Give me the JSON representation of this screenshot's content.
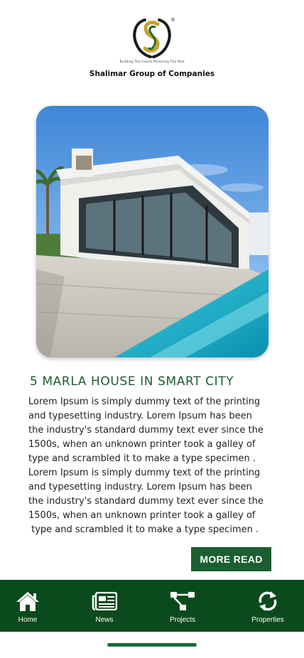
{
  "logo": {
    "tagline": "Building The Future Restoring The Past",
    "company": "Shalimar Group of Companies",
    "registered_mark": "®"
  },
  "article": {
    "title": "5 MARLA HOUSE IN SMART CITY",
    "lines": [
      "Lorem Ipsum is simply dummy text of the printing",
      "and typesetting industry. Lorem Ipsum has been",
      "the industry's standard dummy text ever since the",
      "1500s, when an unknown printer took a galley of",
      "type and scrambled it to make a type specimen .",
      "Lorem Ipsum is simply dummy text of the printing",
      "and typesetting industry. Lorem Ipsum has been",
      "the industry's standard dummy text ever since the",
      "1500s, when an unknown printer took a galley of",
      " type and scrambled it to make a type specimen ."
    ],
    "more_label": "MORE READ"
  },
  "nav": {
    "home": {
      "label": "Home",
      "icon": "home-icon"
    },
    "news": {
      "label": "News",
      "icon": "newspaper-icon"
    },
    "projects": {
      "label": "Projects",
      "icon": "sitemap-icon"
    },
    "properties": {
      "label": "Properties",
      "icon": "refresh-icon"
    }
  },
  "colors": {
    "brand_green": "#1a5c2e",
    "nav_background": "#0b4a1c",
    "logo_gold": "#c9a227"
  }
}
